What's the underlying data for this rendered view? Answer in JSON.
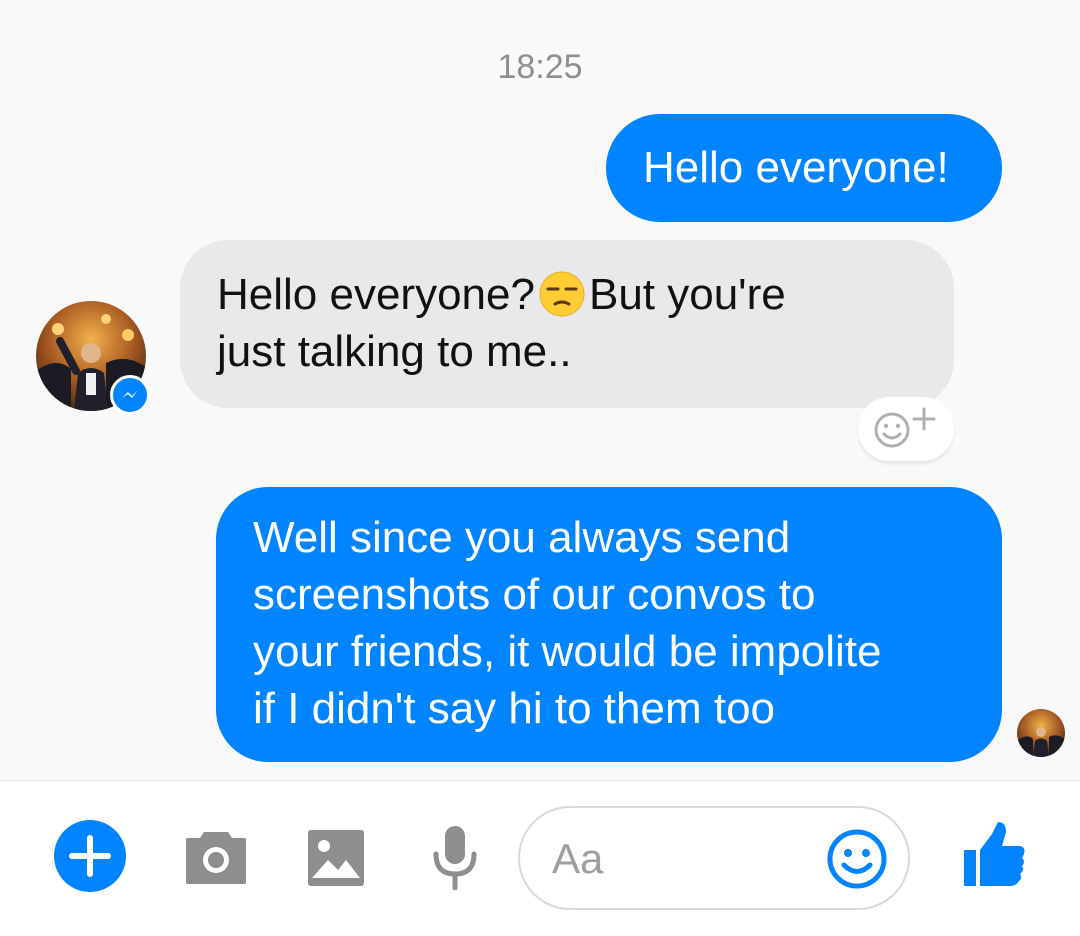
{
  "thread": {
    "timestamp": "18:25",
    "messages": [
      {
        "direction": "outgoing",
        "text_lines": [
          "Hello everyone!"
        ]
      },
      {
        "direction": "incoming",
        "text_before_emoji": "Hello everyone?",
        "emoji": "unamused-face-emoji",
        "text_after_emoji": "But you're",
        "text_line2": "just talking to me.."
      },
      {
        "direction": "outgoing",
        "text_lines": [
          "Well since you always send",
          "screenshots of our convos to",
          "your friends, it would be impolite",
          "if I didn't say hi to them too"
        ]
      }
    ]
  },
  "composer": {
    "placeholder": "Aa",
    "icons": [
      "plus-icon",
      "camera-icon",
      "image-icon",
      "microphone-icon",
      "smiley-icon",
      "thumbs-up-icon"
    ]
  },
  "colors": {
    "accent": "#0084ff",
    "incoming_bubble": "#e9e9eb",
    "background": "#f9f9f9",
    "icon_gray": "#8e8e8e"
  }
}
